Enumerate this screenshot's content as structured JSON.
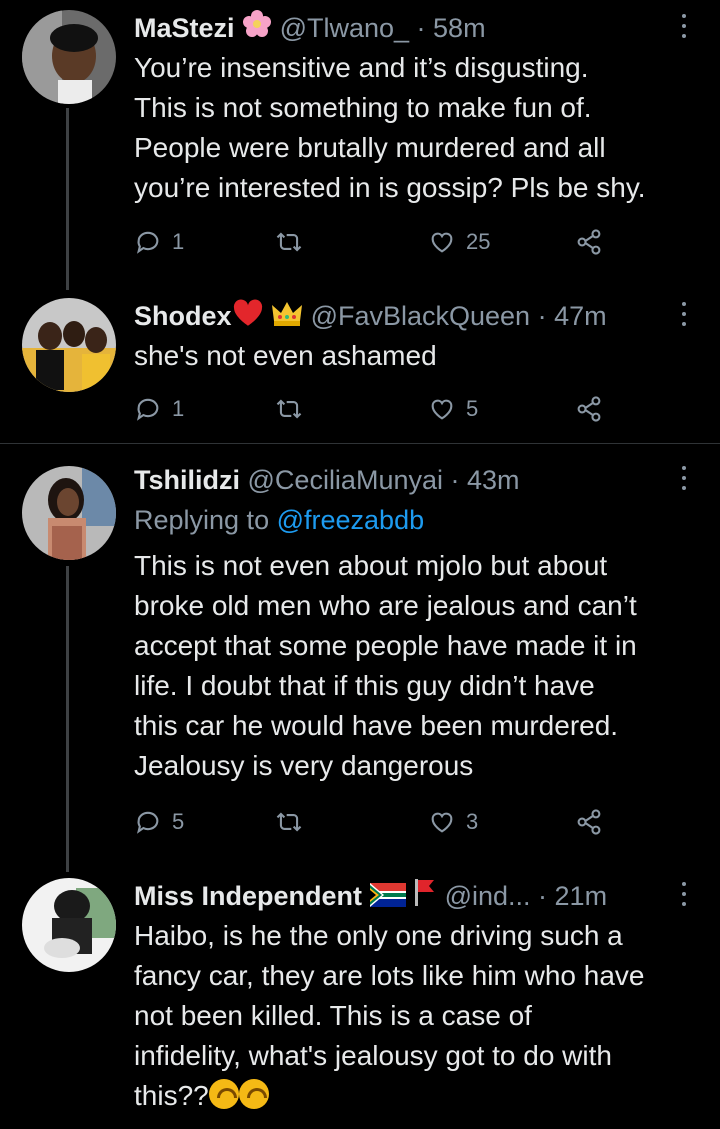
{
  "tweets": [
    {
      "name": "MaStezi",
      "handle": "@Tlwano_",
      "time": "· 58m",
      "text_lines": [
        "You’re insensitive and it’s disgusting.",
        "This is not something to make fun of.",
        "People were brutally murdered and all",
        "you’re interested in is gossip? Pls be shy."
      ],
      "replies": "1",
      "retweets": "",
      "likes": "25",
      "badges": [
        "pink-flower-emoji"
      ]
    },
    {
      "name": "Shodex",
      "handle": "@FavBlackQueen",
      "time": "· 47m",
      "text_lines": [
        "she's not even ashamed"
      ],
      "replies": "1",
      "retweets": "",
      "likes": "5",
      "badges": [
        "red-heart-emoji",
        "crown-emoji"
      ]
    },
    {
      "name": "Tshilidzi",
      "handle": "@CeciliaMunyai",
      "time": "· 43m",
      "replying_prefix": "Replying to",
      "replying_to": "@freezabdb",
      "text_lines": [
        "This is not even about mjolo but about",
        "broke old men who are jealous and can’t",
        "accept that some people have made it in",
        "life. I doubt that if this guy didn’t have",
        "this car he would have been murdered.",
        "Jealousy is very dangerous"
      ],
      "replies": "5",
      "retweets": "",
      "likes": "3"
    },
    {
      "name": "Miss Independent",
      "handle": "@ind...",
      "time": "· 21m",
      "text_lines": [
        "Haibo, is he the only one driving such a",
        "fancy car, they are lots like him who have",
        "not been killed. This is a case of",
        "infidelity, what's jealousy got to do with",
        "this??"
      ],
      "badges": [
        "south-africa-flag-emoji",
        "red-flag-emoji"
      ],
      "trailing_emojis": [
        "upside-down-face-emoji",
        "upside-down-face-emoji"
      ]
    }
  ],
  "colors": {
    "background": "#000000",
    "text": "#e7e9ea",
    "secondary": "#8b98a5",
    "link": "#1d9bf0",
    "divider": "#2f3336"
  }
}
